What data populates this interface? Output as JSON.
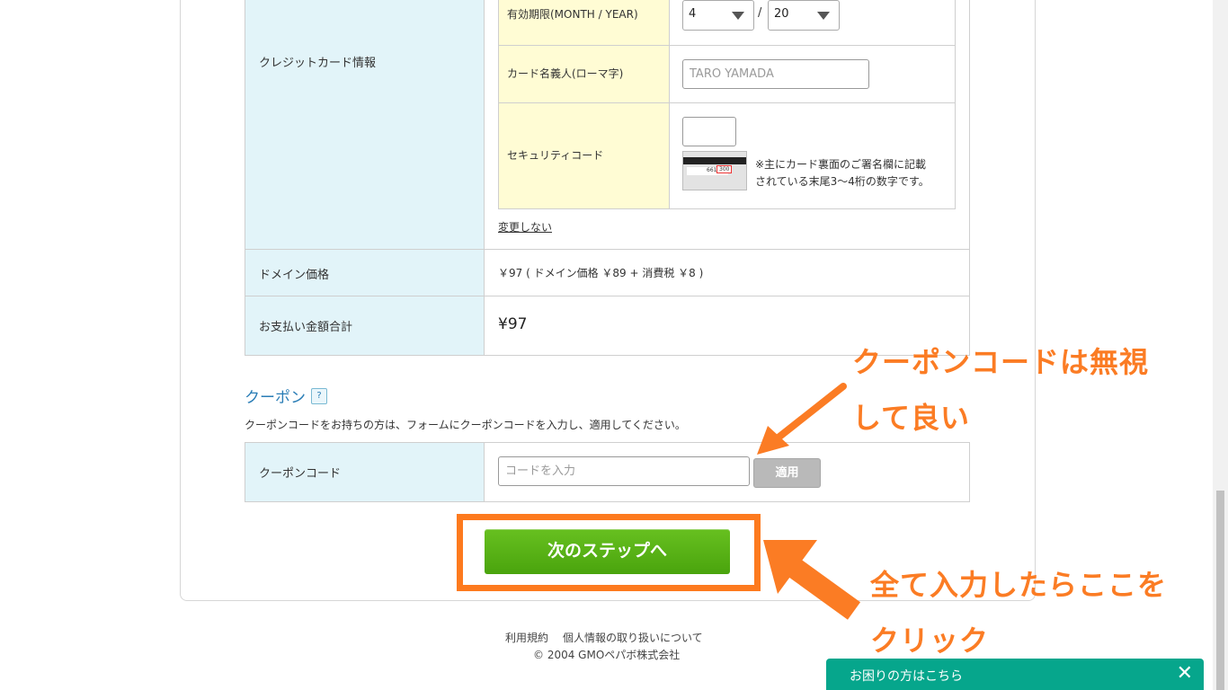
{
  "payment_table": {
    "credit_card_label": "クレジットカード情報",
    "expiry": {
      "label": "有効期限(MONTH / YEAR)",
      "month_value": "4",
      "separator": "/",
      "year_value": "20"
    },
    "card_holder": {
      "label": "カード名義人(ローマ字)",
      "placeholder": "TARO YAMADA"
    },
    "security_code": {
      "label": "セキュリティコード",
      "note_line1": "※主にカード裏面のご署名欄に記載",
      "note_line2": "されている末尾3〜4桁の数字です。",
      "card_image_digits": "6610",
      "card_image_code": "300"
    },
    "no_change_link": "変更しない",
    "domain_price": {
      "label": "ドメイン価格",
      "value": "￥97 ( ドメイン価格 ￥89 + 消費税 ￥8 )"
    },
    "total": {
      "label": "お支払い金額合計",
      "value": "¥97"
    }
  },
  "coupon": {
    "heading": "クーポン",
    "help_icon": "?",
    "description": "クーポンコードをお持ちの方は、フォームにクーポンコードを入力し、適用してください。",
    "row_label": "クーポンコード",
    "placeholder": "コードを入力",
    "apply_button": "適用"
  },
  "next_button": "次のステップへ",
  "annotations": {
    "coupon_note_line1": "クーポンコードは無視",
    "coupon_note_line2": "して良い",
    "click_note_line1": "全て入力したらここを",
    "click_note_line2": "クリック",
    "color": "#fb7c24"
  },
  "footer": {
    "terms": "利用規約",
    "privacy": "個人情報の取り扱いについて",
    "copyright": "© 2004 GMOペパボ株式会社"
  },
  "help_bar": {
    "text": "お困りの方はこちら",
    "close": "✕",
    "color": "#06a68c"
  }
}
